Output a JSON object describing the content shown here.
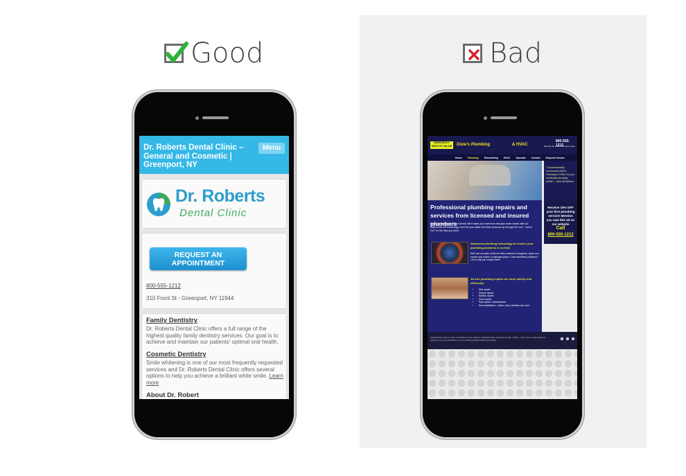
{
  "good": {
    "label": "Good",
    "site": {
      "header_title": "Dr. Roberts Dental Clinic – General and Cosmetic | Greenport, NY",
      "menu_label": "Menu",
      "logo_name": "Dr. Roberts",
      "logo_sub": "Dental Clinic",
      "appointment_label": "REQUEST AN APPOINTMENT",
      "phone": "800-555-1212",
      "address": "310 Front St - Greenport, NY 11944",
      "sections": [
        {
          "heading": "Family Dentistry",
          "body": "Dr. Roberts Dental Clinic offers a full range of the highest quality family dentistry services. Our goal is to achieve and maintain our patients' optimal oral health."
        },
        {
          "heading": "Cosmetic Dentistry",
          "body": "Smile whitening is one of our most frequently requested services and Dr. Roberts Dental Clinic offers several options to help you achieve a brilliant white smile.",
          "link": "Learn more"
        },
        {
          "heading": "About Dr. Robert"
        }
      ]
    }
  },
  "bad": {
    "label": "Bad",
    "site": {
      "hours_badge": "EMERGENCY SERVICE ONLINE",
      "brand": "Dixie's Plumbing",
      "brand_suffix": "& HVAC",
      "phone_top": "800-555-1212",
      "serving": "Serving the entire Greenport area",
      "nav": [
        "Home",
        "Plumbing",
        "Remodeling",
        "HVAC",
        "Specials",
        "Contact",
        "Request Service"
      ],
      "quote": "\"I wholeheartedly recommend Dixie's Plumbing & HVAC for your residential plumbing needs\" – John McGillman",
      "headline": "Professional plumbing repairs and services from licensed and insured plumbers",
      "intro": "Plumbing problems? Don't stress! We'll make your bathroom and pipe woes vanish with our state-of-the-art technology. Don't let your water and drain pressure go through the roof – call us 24/7 for the help you need.",
      "feature1_title": "Advanced plumbing technology to resolve your plumbing problems in no time",
      "feature1_text": "We'll use our state-of-the-art video cameras to diagnose, repair and replace any broken or damaged pipes. Costs shrinkless problems? Let us help you contact them!",
      "feature2_title": "All size plumbing repairs are done quickly and efficiently:",
      "feature2_list": [
        "Sink repairs",
        "Shower repairs",
        "Bathtub repairs",
        "Drain repairs",
        "Pipe repairs / replacements",
        "New installations – toilets, sinks, bathtubs and more"
      ],
      "promo_text": "Receive 15% OFF your first plumbing service! Mention you saw this ad on our website",
      "promo_call": "Call",
      "promo_number": "800-555-1212",
      "footer_text": "Privacy Policy | Terms of Use | Conditions of Use | Returns | Shipping Policy | Powered by Site. © 2014 – The content of this website is owned by us; any reproduction or use is strictly prohibited without permission."
    }
  },
  "colors": {
    "good_header": "#35b8e6",
    "good_check": "#2bb33a",
    "bad_x": "#d0242b",
    "bad_site_bg": "#222374",
    "bad_accent": "#e8ef24"
  }
}
